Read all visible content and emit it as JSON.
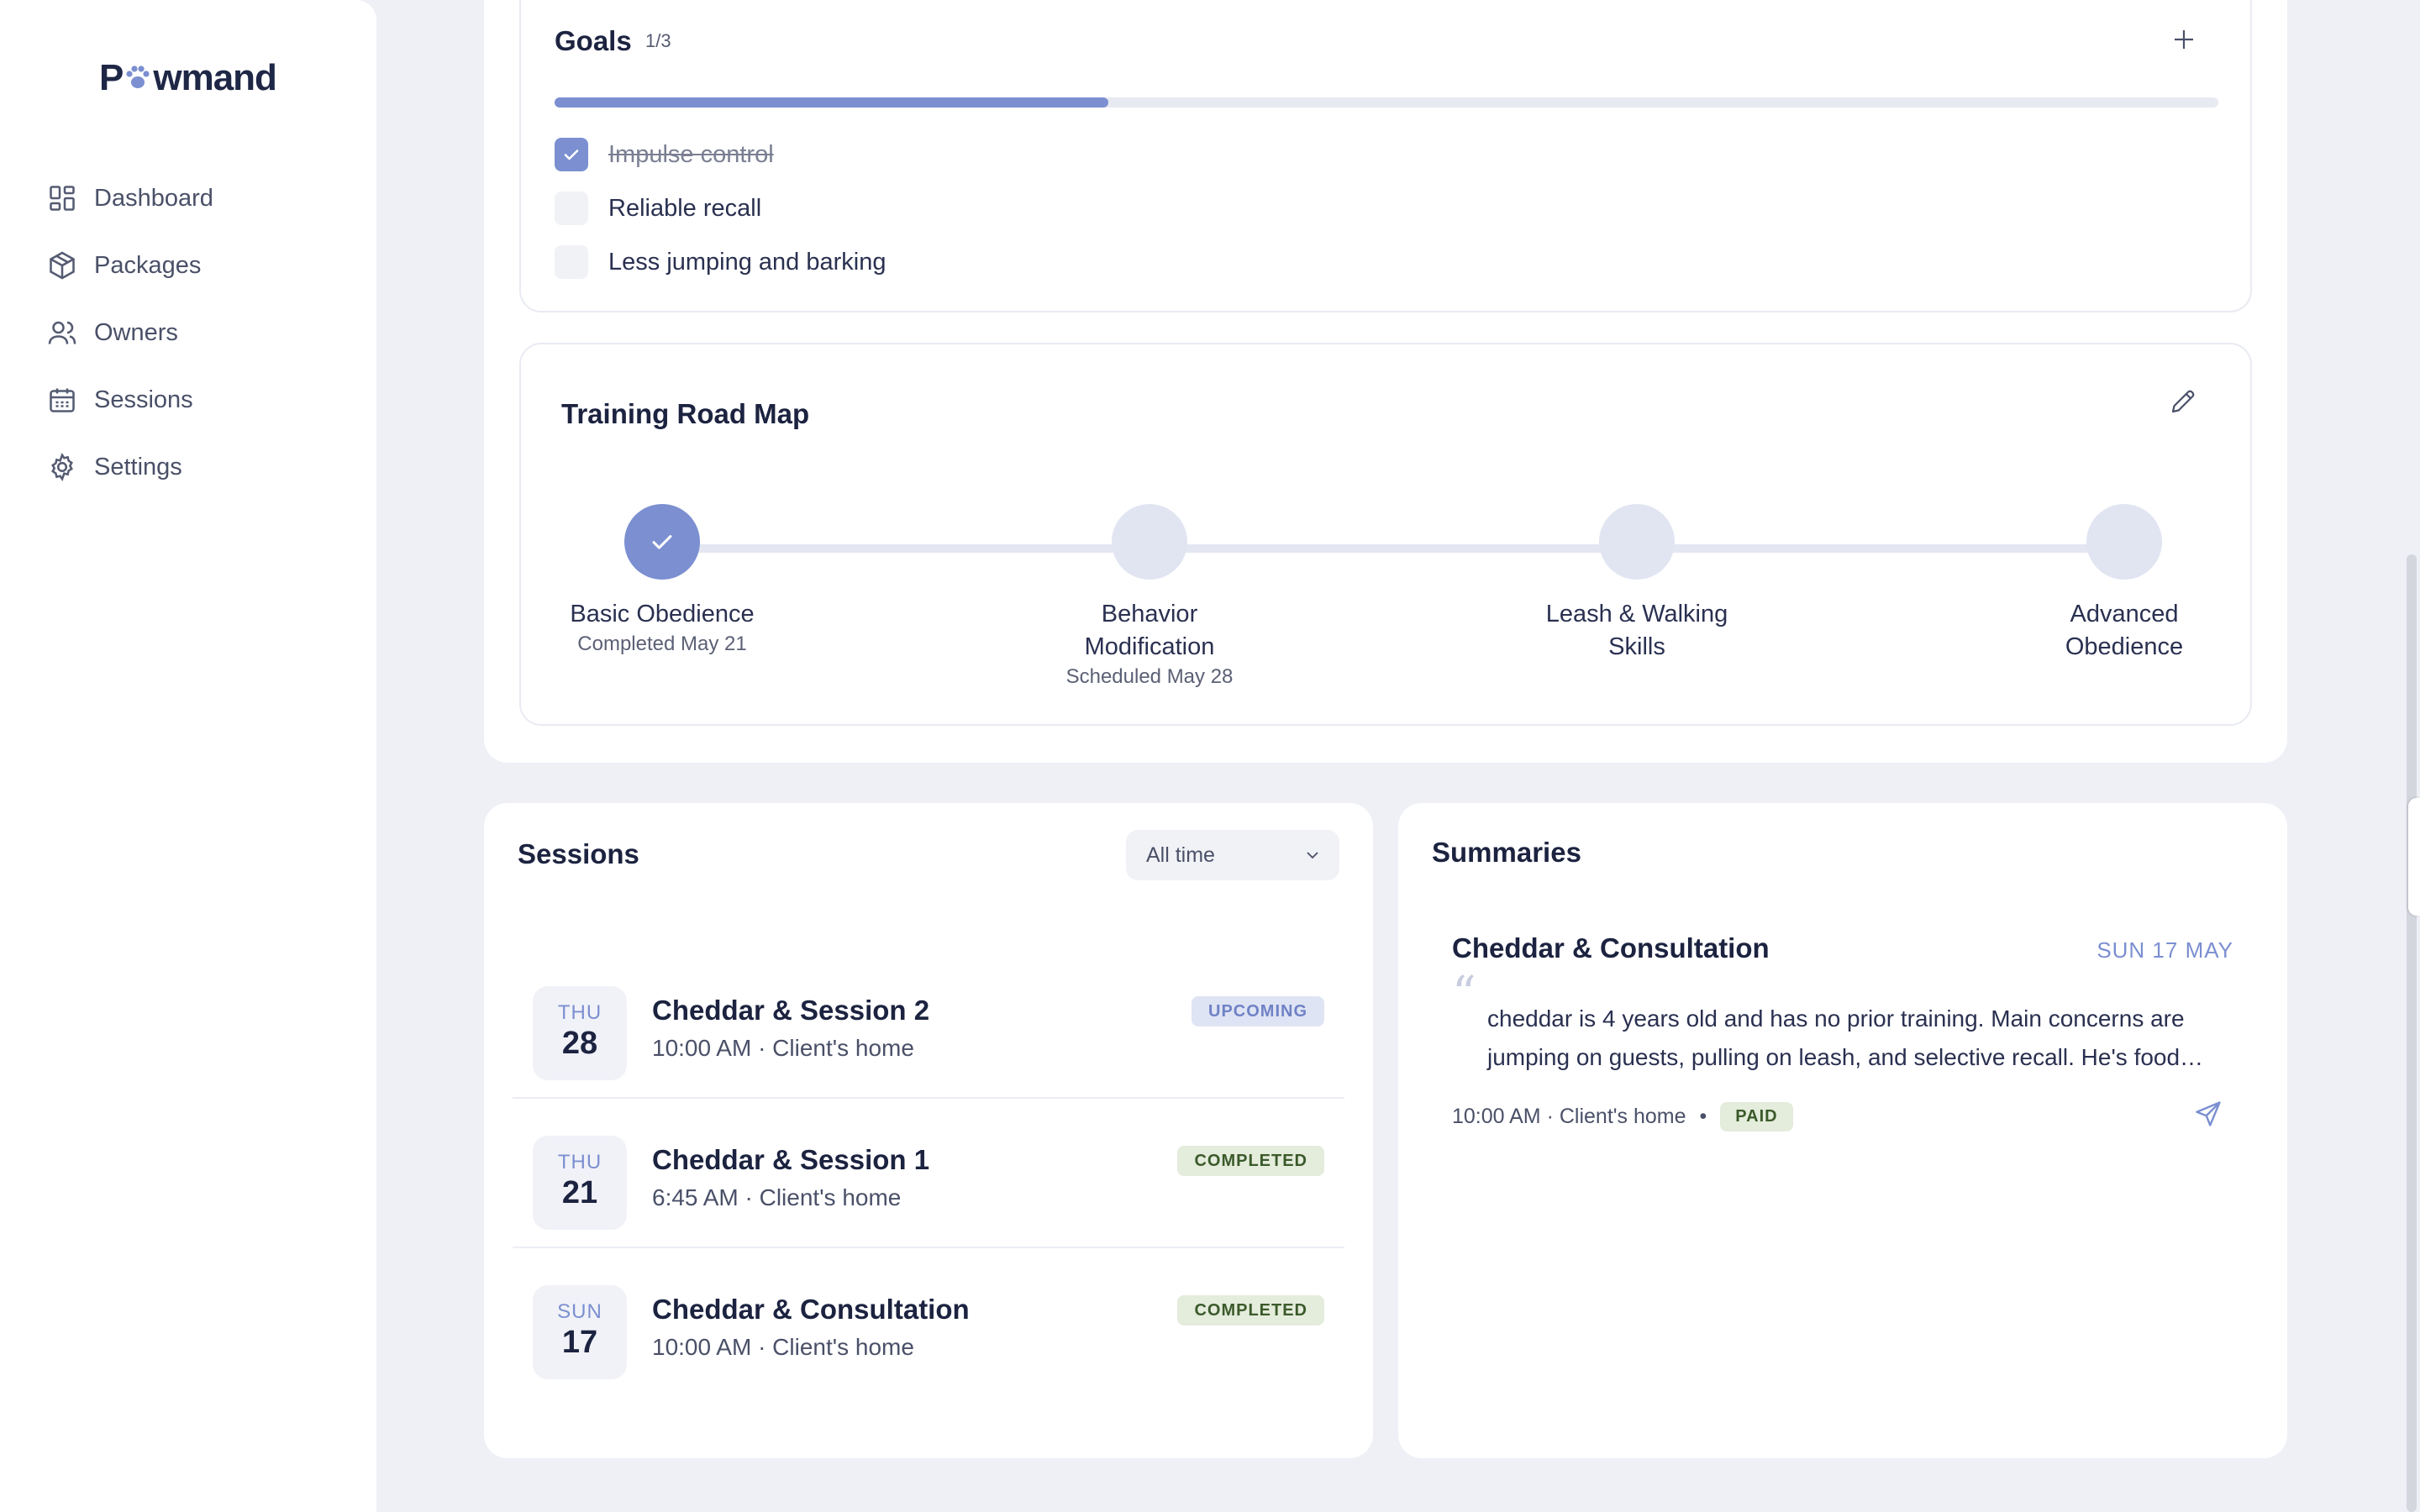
{
  "brand": {
    "name_prefix": "P",
    "name_suffix": "wmand",
    "accent": "#7b8fd1"
  },
  "sidebar": {
    "items": [
      {
        "label": "Dashboard",
        "icon": "grid-icon"
      },
      {
        "label": "Packages",
        "icon": "box-icon"
      },
      {
        "label": "Owners",
        "icon": "users-icon"
      },
      {
        "label": "Sessions",
        "icon": "calendar-icon"
      },
      {
        "label": "Settings",
        "icon": "gear-icon"
      }
    ]
  },
  "goals": {
    "title": "Goals",
    "count": "1/3",
    "progress": 0.333,
    "items": [
      {
        "label": "Impulse control",
        "done": true
      },
      {
        "label": "Reliable recall",
        "done": false
      },
      {
        "label": "Less jumping and barking",
        "done": false
      }
    ]
  },
  "roadmap": {
    "title": "Training Road Map",
    "milestones": [
      {
        "label": "Basic Obedience",
        "sub": "Completed May 21",
        "done": true
      },
      {
        "label": "Behavior Modification",
        "sub": "Scheduled May 28",
        "done": false
      },
      {
        "label": "Leash & Walking Skills",
        "sub": "",
        "done": false
      },
      {
        "label": "Advanced Obedience",
        "sub": "",
        "done": false
      }
    ]
  },
  "sessions": {
    "title": "Sessions",
    "filter": "All time",
    "items": [
      {
        "dow": "THU",
        "day": "28",
        "title": "Cheddar & Session 2",
        "meta": "10:00 AM · Client's home",
        "status": "UPCOMING"
      },
      {
        "dow": "THU",
        "day": "21",
        "title": "Cheddar & Session 1",
        "meta": "6:45 AM · Client's home",
        "status": "COMPLETED"
      },
      {
        "dow": "SUN",
        "day": "17",
        "title": "Cheddar & Consultation",
        "meta": "10:00 AM · Client's home",
        "status": "COMPLETED"
      }
    ]
  },
  "summaries": {
    "title": "Summaries",
    "item": {
      "title": "Cheddar & Consultation",
      "date": "SUN 17 MAY",
      "text": "cheddar is 4 years old and has no prior training. Main concerns are jumping on guests, pulling on leash, and selective recall. He's food…",
      "meta": "10:00 AM · Client's home",
      "payment": "PAID"
    }
  }
}
